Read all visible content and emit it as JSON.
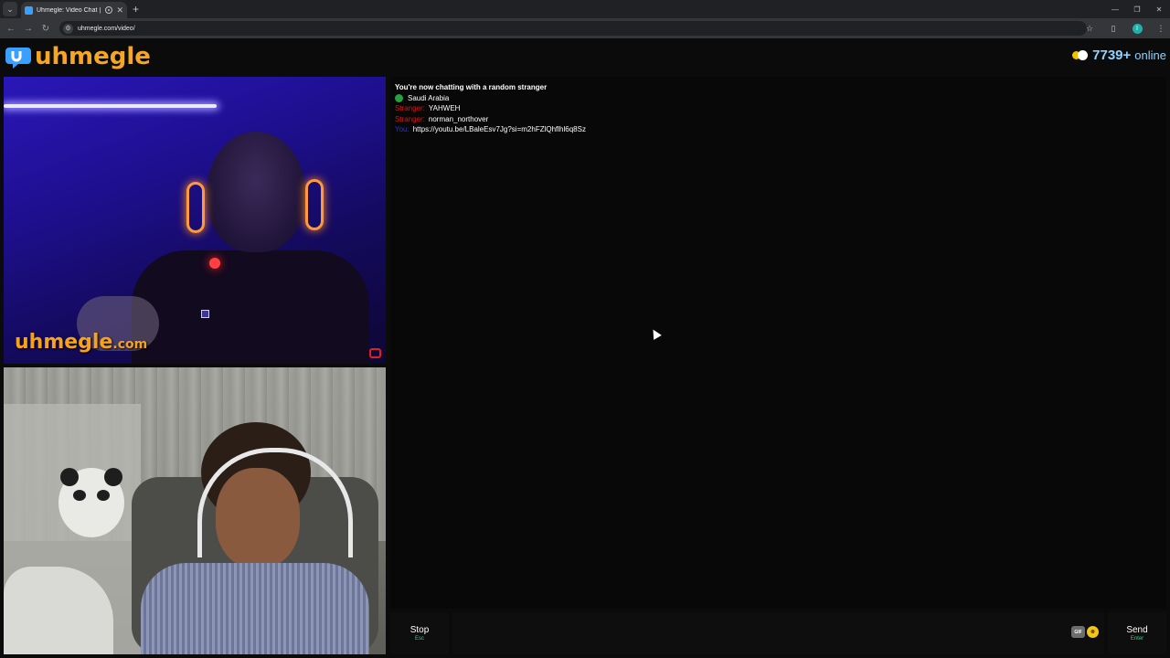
{
  "browser": {
    "tab_title": "Uhmegle: Video Chat | Onl",
    "url": "uhmegle.com/video/",
    "icons": {
      "tab_search": "chevron-down-icon",
      "back": "arrow-left-icon",
      "forward": "arrow-right-icon",
      "reload": "reload-icon",
      "bookmark": "star-icon",
      "extensions": "puzzle-icon",
      "menu": "kebab-menu-icon"
    },
    "profile_initial": "I"
  },
  "site": {
    "logo_text": "uhmegle",
    "online_count": "7739+",
    "online_label": "online",
    "colors": {
      "logo": "#f5a623",
      "online_text": "#8fd3ff",
      "stranger_label": "#d01818",
      "you_label": "#2a36c8",
      "key_hint": "#33d17a"
    }
  },
  "video": {
    "watermark": "uhmegle",
    "watermark_tld": ".com"
  },
  "chat": {
    "status": "You're now chatting with a random stranger",
    "country": "Saudi Arabia",
    "messages": [
      {
        "sender": "Stranger:",
        "text": "YAHWEH"
      },
      {
        "sender": "Stranger:",
        "text": "norman_northover"
      },
      {
        "sender": "You:",
        "text": "https://youtu.be/LBaleEsv7Jg?si=m2hFZlQhflhl6q8Sz"
      }
    ]
  },
  "controls": {
    "stop_label": "Stop",
    "stop_key": "Esc",
    "gif_label": "GIF",
    "send_label": "Send",
    "send_key": "Enter",
    "message_value": ""
  }
}
